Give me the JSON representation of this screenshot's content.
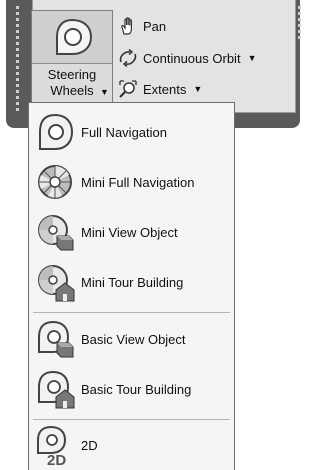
{
  "ribbon": {
    "steering_wheels": {
      "label_line1": "Steering",
      "label_line2": "Wheels",
      "icon": "steering-wheel-icon"
    },
    "pan": {
      "label": "Pan",
      "icon": "pan-hand-icon"
    },
    "continuous_orbit": {
      "label": "Continuous Orbit",
      "icon": "orbit-icon"
    },
    "extents": {
      "label": "Extents",
      "icon": "zoom-extents-icon"
    }
  },
  "menu": {
    "items": [
      {
        "label": "Full Navigation",
        "icon": "full-navigation-wheel-icon"
      },
      {
        "label": "Mini Full Navigation",
        "icon": "mini-full-navigation-wheel-icon"
      },
      {
        "label": "Mini View Object",
        "icon": "mini-view-object-wheel-icon"
      },
      {
        "label": "Mini Tour Building",
        "icon": "mini-tour-building-wheel-icon"
      },
      {
        "label": "Basic View Object",
        "icon": "basic-view-object-wheel-icon"
      },
      {
        "label": "Basic Tour Building",
        "icon": "basic-tour-building-wheel-icon"
      },
      {
        "label": "2D",
        "icon": "2d-wheel-icon",
        "icon_text": "2D"
      }
    ]
  }
}
